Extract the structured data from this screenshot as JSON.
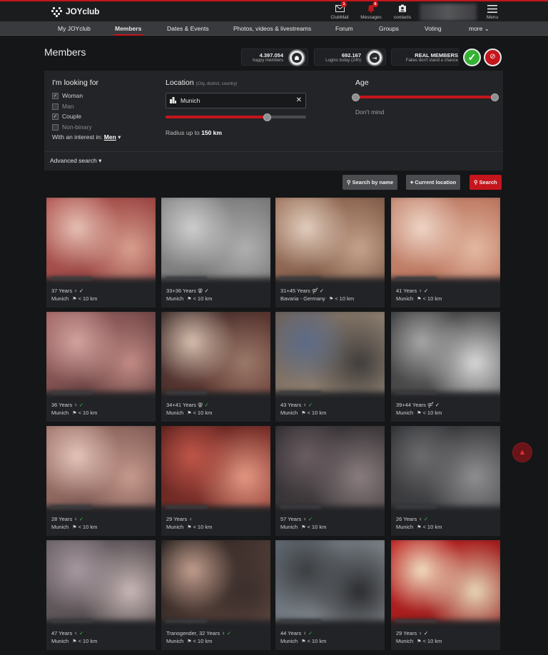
{
  "brand": {
    "name": "JOYclub"
  },
  "topbar": {
    "items": [
      {
        "label": "ClubMail",
        "badge": "1",
        "icon": "mail-icon"
      },
      {
        "label": "Messages",
        "badge": "6",
        "icon": "bell-icon"
      },
      {
        "label": "contacts",
        "badge": "",
        "icon": "contacts-icon"
      },
      {
        "label": "Menu",
        "badge": "",
        "icon": "hamburger-icon"
      }
    ]
  },
  "nav": {
    "items": [
      "My JOYclub",
      "Members",
      "Dates & Events",
      "Photos, videos & livestreams",
      "Forum",
      "Groups",
      "Voting",
      "more"
    ],
    "active": "Members"
  },
  "page": {
    "title": "Members"
  },
  "stats": {
    "members_count": "4.397.054",
    "members_label": "happy members",
    "logins_count": "692.167",
    "logins_label": "Logins today (24h)",
    "real_title": "REAL MEMBERS",
    "real_sub": "Fakes don't stand a chance"
  },
  "filters": {
    "looking_for_title": "I'm looking for",
    "options": [
      {
        "label": "Woman",
        "checked": true
      },
      {
        "label": "Man",
        "checked": false
      },
      {
        "label": "Couple",
        "checked": true
      },
      {
        "label": "Non-binary",
        "checked": false
      }
    ],
    "interest_prefix": "With an interest in:",
    "interest_value": "Men",
    "location_title": "Location",
    "location_hint": "(City, district, country)",
    "location_value": "Munich",
    "radius_prefix": "Radius up to",
    "radius_value": "150 km",
    "radius_fraction": 0.72,
    "age_title": "Age",
    "age_value": "Don't mind",
    "advanced": "Advanced search"
  },
  "buttons": {
    "search_by_name": "Search by name",
    "current_location": "Current location",
    "search": "Search"
  },
  "results": [
    {
      "age": "37 Years",
      "gender": "♀",
      "verified": "white",
      "location": "Munich",
      "distance": "< 10 km"
    },
    {
      "age": "33+36 Years",
      "gender": "⚢",
      "verified": "white",
      "location": "Munich",
      "distance": "< 10 km"
    },
    {
      "age": "31+45 Years",
      "gender": "⚤",
      "verified": "white",
      "location": "Bavaria - Germany",
      "distance": "< 10 km"
    },
    {
      "age": "41 Years",
      "gender": "♀",
      "verified": "white",
      "location": "Munich",
      "distance": "< 10 km"
    },
    {
      "age": "36 Years",
      "gender": "♀",
      "verified": "green",
      "location": "Munich",
      "distance": "< 10 km"
    },
    {
      "age": "34+41 Years",
      "gender": "⚢",
      "verified": "green",
      "location": "Munich",
      "distance": "< 10 km"
    },
    {
      "age": "43 Years",
      "gender": "♀",
      "verified": "green",
      "location": "Munich",
      "distance": "< 10 km"
    },
    {
      "age": "39+44 Years",
      "gender": "⚤",
      "verified": "white",
      "location": "Munich",
      "distance": "< 10 km"
    },
    {
      "age": "28 Years",
      "gender": "♀",
      "verified": "green",
      "location": "Munich",
      "distance": "< 10 km"
    },
    {
      "age": "29 Years",
      "gender": "♀",
      "verified": "none",
      "location": "Munich",
      "distance": "< 10 km"
    },
    {
      "age": "57 Years",
      "gender": "♀",
      "verified": "green",
      "location": "Munich",
      "distance": "< 10 km"
    },
    {
      "age": "26 Years",
      "gender": "♀",
      "verified": "green",
      "location": "Munich",
      "distance": "< 10 km"
    },
    {
      "age": "47 Years",
      "gender": "♀",
      "verified": "green",
      "location": "Munich",
      "distance": "< 10 km"
    },
    {
      "age": "Transgender, 32 Years",
      "gender": "♀",
      "verified": "green",
      "location": "Munich",
      "distance": "< 10 km"
    },
    {
      "age": "44 Years",
      "gender": "♀",
      "verified": "green",
      "location": "Munich",
      "distance": "< 10 km"
    },
    {
      "age": "29 Years",
      "gender": "♀",
      "verified": "white",
      "location": "Munich",
      "distance": "< 10 km"
    }
  ],
  "colors": {
    "accent": "#c4161c",
    "verified_green": "#36c24a",
    "background": "#151618"
  }
}
